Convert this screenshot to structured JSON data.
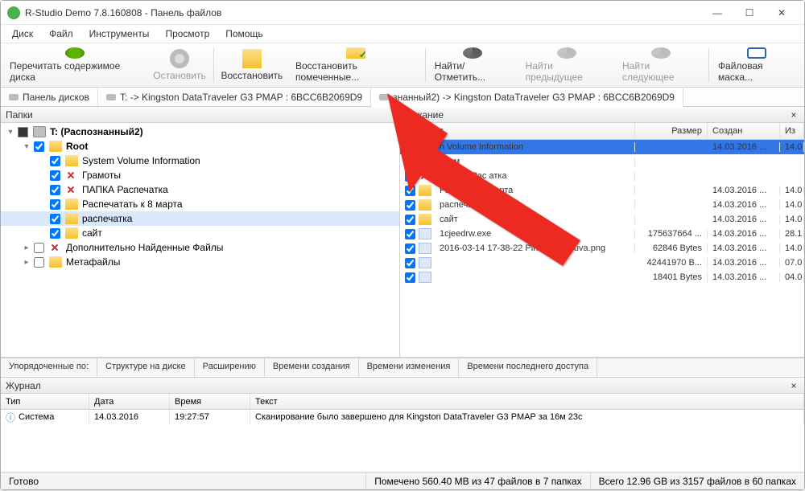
{
  "window": {
    "title": "R-Studio Demo 7.8.160808 - Панель файлов"
  },
  "menu": [
    "Диск",
    "Файл",
    "Инструменты",
    "Просмотр",
    "Помощь"
  ],
  "toolbar": [
    {
      "id": "reload",
      "label": "Перечитать содержимое диска",
      "enabled": true
    },
    {
      "id": "stop",
      "label": "Остановить",
      "enabled": false
    },
    {
      "id": "recover",
      "label": "Восстановить",
      "enabled": true
    },
    {
      "id": "recovermk",
      "label": "Восстановить помеченные...",
      "enabled": true
    },
    {
      "id": "find",
      "label": "Найти/Отметить...",
      "enabled": true
    },
    {
      "id": "findprev",
      "label": "Найти предыдущее",
      "enabled": false
    },
    {
      "id": "findnext",
      "label": "Найти следующее",
      "enabled": false
    },
    {
      "id": "filemask",
      "label": "Файловая маска...",
      "enabled": true
    }
  ],
  "tabs": [
    {
      "label": "Панель дисков"
    },
    {
      "label": "T: -> Kingston DataTraveler G3 PMAP : 6BCC6B2069D9"
    },
    {
      "label": "знанный2) -> Kingston DataTraveler G3 PMAP : 6BCC6B2069D9"
    }
  ],
  "left_pane": {
    "title": "Папки",
    "root_label": "T: (Распознанный2)",
    "nodes": [
      {
        "label": "Root",
        "indent": 1,
        "checked": true,
        "bold": true,
        "icon": "folder",
        "expander": "open"
      },
      {
        "label": "System Volume Information",
        "indent": 2,
        "checked": true,
        "icon": "folder"
      },
      {
        "label": "Грамоты",
        "indent": 2,
        "checked": true,
        "icon": "redx"
      },
      {
        "label": "ПАПКА Распечатка",
        "indent": 2,
        "checked": true,
        "icon": "redx"
      },
      {
        "label": "Распечатать к 8 марта",
        "indent": 2,
        "checked": true,
        "icon": "folder"
      },
      {
        "label": "распечатка",
        "indent": 2,
        "checked": true,
        "icon": "folder",
        "selected": true
      },
      {
        "label": "сайт",
        "indent": 2,
        "checked": true,
        "icon": "folder"
      },
      {
        "label": "Дополнительно Найденные Файлы",
        "indent": 1,
        "checked": false,
        "icon": "redx",
        "expander": "closed"
      },
      {
        "label": "Метафайлы",
        "indent": 1,
        "checked": false,
        "icon": "folder",
        "expander": "closed"
      }
    ]
  },
  "right_pane": {
    "title": "ержание",
    "columns": {
      "name": "Имя",
      "size": "Размер",
      "created": "Создан",
      "mod": "Из"
    },
    "rows": [
      {
        "name": "n Volume Information",
        "size": "",
        "created": "14.03.2016 ...",
        "mod": "14.0",
        "icon": "folder",
        "selected": true
      },
      {
        "name": "Грам",
        "size": "",
        "created": "",
        "mod": "",
        "icon": "redx"
      },
      {
        "name": "ПАПКА Рас       атка",
        "size": "",
        "created": "",
        "mod": "",
        "icon": "redx"
      },
      {
        "name": "Распечатать к    рта",
        "size": "",
        "created": "14.03.2016 ...",
        "mod": "14.0",
        "icon": "folder"
      },
      {
        "name": "распечатка",
        "size": "",
        "created": "14.03.2016 ...",
        "mod": "14.0",
        "icon": "folder"
      },
      {
        "name": "сайт",
        "size": "",
        "created": "14.03.2016 ...",
        "mod": "14.0",
        "icon": "folder"
      },
      {
        "name": "1cjeedrw.exe",
        "size": "175637664 ...",
        "created": "14.03.2016 ...",
        "mod": "28.1",
        "icon": "file"
      },
      {
        "name": "2016-03-14 17-38-22 Piriform Recuva.png",
        "size": "62846 Bytes",
        "created": "14.03.2016 ...",
        "mod": "14.0",
        "icon": "file"
      },
      {
        "name": " ",
        "size": "42441970 B...",
        "created": "14.03.2016 ...",
        "mod": "07.0",
        "icon": "file",
        "blur": true
      },
      {
        "name": " ",
        "size": "18401 Bytes",
        "created": "14.03.2016 ...",
        "mod": "04.0",
        "icon": "file",
        "blur": true
      }
    ]
  },
  "sort_tabs": [
    "Упорядоченные по:",
    "Структуре на диске",
    "Расширению",
    "Времени создания",
    "Времени изменения",
    "Времени последнего доступа"
  ],
  "journal": {
    "title": "Журнал",
    "columns": {
      "type": "Тип",
      "date": "Дата",
      "time": "Время",
      "text": "Текст"
    },
    "rows": [
      {
        "type": "Система",
        "date": "14.03.2016",
        "time": "19:27:57",
        "text": "Сканирование было завершено для Kingston DataTraveler G3 PMAP за 16м 23с"
      }
    ]
  },
  "status": {
    "ready": "Готово",
    "marked": "Помечено 560.40 MB из 47 файлов в 7 папках",
    "total": "Всего 12.96 GB из 3157 файлов в 60 папках"
  }
}
